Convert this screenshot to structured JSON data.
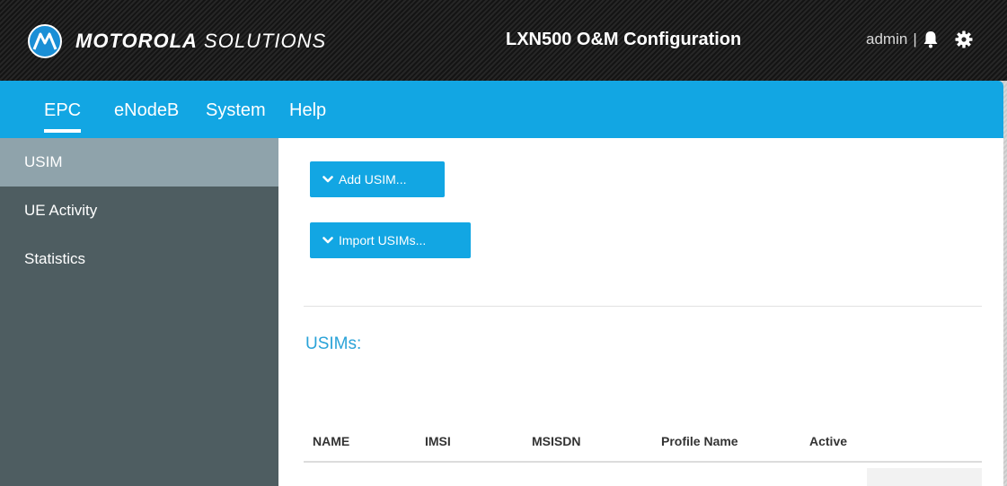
{
  "header": {
    "brand_bold": "MOTOROLA",
    "brand_light": "SOLUTIONS",
    "app_title": "LXN500 O&M Configuration",
    "user": "admin",
    "separator": "|"
  },
  "nav": {
    "tabs": [
      {
        "label": "EPC",
        "active": true
      },
      {
        "label": "eNodeB",
        "active": false
      },
      {
        "label": "System",
        "active": false
      },
      {
        "label": "Help",
        "active": false
      }
    ]
  },
  "sidebar": {
    "items": [
      {
        "label": "USIM",
        "active": true
      },
      {
        "label": "UE Activity",
        "active": false
      },
      {
        "label": "Statistics",
        "active": false
      }
    ]
  },
  "main": {
    "add_button": "Add USIM...",
    "import_button": "Import USIMs...",
    "section_title": "USIMs:",
    "table": {
      "columns": [
        "NAME",
        "IMSI",
        "MSISDN",
        "Profile Name",
        "Active"
      ]
    }
  },
  "colors": {
    "accent": "#12a6e3",
    "sidebar_bg": "#4e5d61",
    "sidebar_active": "#8fa3ab",
    "section_title": "#2aa3d8"
  },
  "icons": {
    "logo": "motorola-m-logo-icon",
    "notification": "bell-icon",
    "settings": "gear-icon",
    "chevron": "chevron-down-icon"
  }
}
